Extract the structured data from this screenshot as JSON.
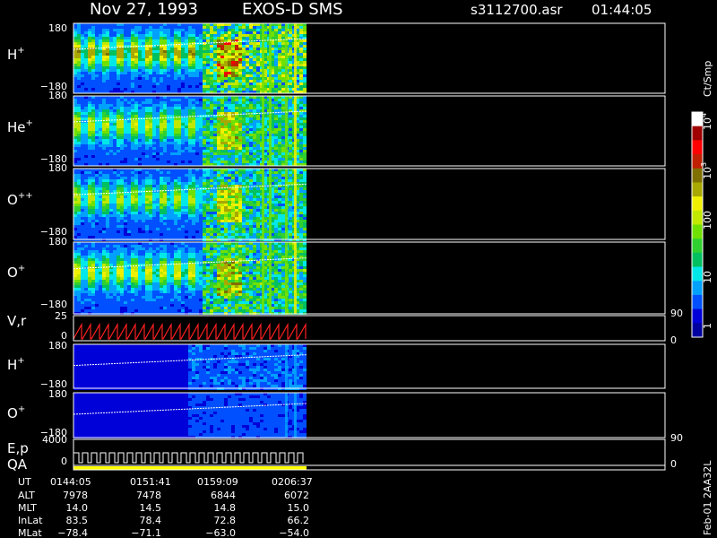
{
  "header": {
    "date": "Nov 27, 1993",
    "instrument": "EXOS-D SMS",
    "file": "s3112700.asr",
    "time": "01:44:05"
  },
  "colors": {
    "background": "#000000",
    "axis": "#ffffff",
    "trace": "#ff2020",
    "quality": "#ffff00"
  },
  "chart_data": {
    "type": "heatmap",
    "panels": [
      {
        "id": "h_plus",
        "ion": "H",
        "charge": "+",
        "ytop": "180",
        "ybottom": "−180",
        "intensity": 1.0
      },
      {
        "id": "he_plus",
        "ion": "He",
        "charge": "+",
        "ytop": "180",
        "ybottom": "−180",
        "intensity": 0.75
      },
      {
        "id": "o_plusplus",
        "ion": "O",
        "charge": "++",
        "ytop": "180",
        "ybottom": "−180",
        "intensity": 0.72
      },
      {
        "id": "o_plus",
        "ion": "O",
        "charge": "+",
        "ytop": "180",
        "ybottom": "−180",
        "intensity": 0.8
      },
      {
        "id": "h_plus_2",
        "ion": "H",
        "charge": "+",
        "ytop": "180",
        "ybottom": "−180",
        "intensity": 0.35
      },
      {
        "id": "o_plus_2",
        "ion": "O",
        "charge": "+",
        "ytop": "180",
        "ybottom": "−180",
        "intensity": 0.25
      }
    ],
    "vr_panel": {
      "label": "V,r",
      "ytop": "25",
      "ybottom": "0",
      "right_top": "90",
      "right_bottom": "0"
    },
    "ep_panel": {
      "label1": "E,p",
      "label2": "QA",
      "ytop": "4000",
      "ybottom": "0",
      "right_top": "90",
      "right_bottom": "0"
    },
    "colorbar": {
      "unit": "Ct/Smp",
      "labels": [
        {
          "text": "1",
          "value": 1
        },
        {
          "text": "10",
          "value": 10
        },
        {
          "text": "100",
          "value": 100
        },
        {
          "text": "10",
          "sup": "3",
          "value": 1000
        },
        {
          "text": "10",
          "sup": "4",
          "value": 10000
        }
      ],
      "colors": [
        "#0000a0",
        "#0000d8",
        "#0050ff",
        "#00a0ff",
        "#00e8e8",
        "#00c060",
        "#30d030",
        "#70e000",
        "#c0e800",
        "#f0f000",
        "#a8a800",
        "#807000",
        "#c02000",
        "#ff0000",
        "#a00000",
        "#ffffff"
      ]
    },
    "orbit_table": {
      "rows": [
        {
          "label": "UT",
          "values": [
            "0144:05",
            "0151:41",
            "0159:09",
            "0206:37"
          ]
        },
        {
          "label": "ALT",
          "values": [
            "7978",
            "7478",
            "6844",
            "6072"
          ]
        },
        {
          "label": "MLT",
          "values": [
            "14.0",
            "14.5",
            "14.8",
            "15.0"
          ]
        },
        {
          "label": "InLat",
          "values": [
            "83.5",
            "78.4",
            "72.8",
            "66.2"
          ]
        },
        {
          "label": "MLat",
          "values": [
            "−78.4",
            "−71.1",
            "−63.0",
            "−54.0"
          ]
        }
      ]
    },
    "footer_id": "Feb-01 2AA32L"
  }
}
